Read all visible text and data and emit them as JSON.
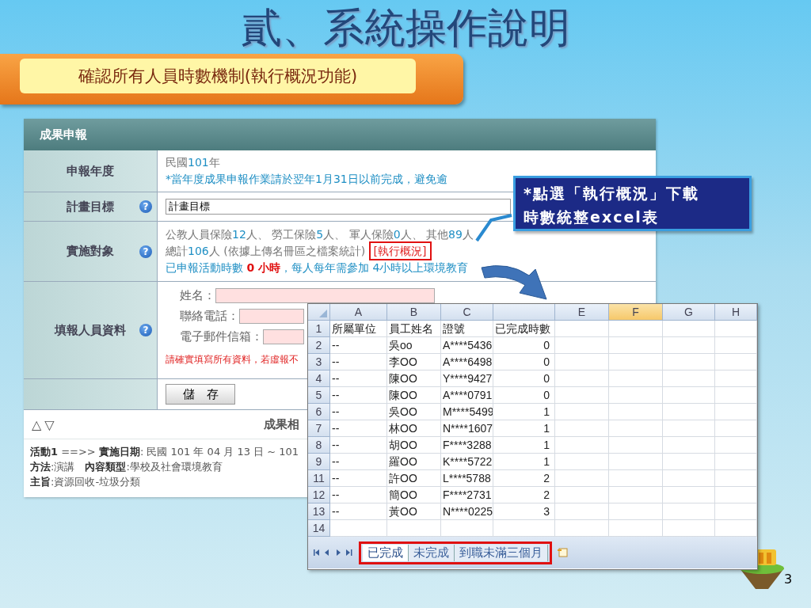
{
  "slide": {
    "title": "貳、系統操作說明",
    "subtitle": "確認所有人員時數機制(執行概況功能)",
    "page_number": "3"
  },
  "form": {
    "header": "成果申報",
    "rows": [
      {
        "kind": "text",
        "label": "申報年度",
        "lines": [
          [
            {
              "text": "民國",
              "kind": "plain"
            },
            {
              "text": "101",
              "kind": "accent"
            },
            {
              "text": "年",
              "kind": "plain"
            }
          ],
          [
            {
              "text": "*當年度成果申報作業請於翌年1月31日以前完成，避免逾",
              "kind": "accent"
            }
          ]
        ]
      },
      {
        "kind": "input",
        "label": "計畫目標",
        "help": "?",
        "value": "計畫目標"
      },
      {
        "kind": "text",
        "label": "實施對象",
        "help": "?",
        "lines": [
          [
            {
              "text": "公教人員保險",
              "kind": "plain"
            },
            {
              "text": "12",
              "kind": "accent"
            },
            {
              "text": "人、 勞工保險",
              "kind": "plain"
            },
            {
              "text": "5",
              "kind": "accent"
            },
            {
              "text": "人、 軍人保險",
              "kind": "plain"
            },
            {
              "text": "0",
              "kind": "accent"
            },
            {
              "text": "人、 其他",
              "kind": "plain"
            },
            {
              "text": "89",
              "kind": "accent"
            },
            {
              "text": "人",
              "kind": "plain"
            }
          ],
          [
            {
              "text": "總計",
              "kind": "plain"
            },
            {
              "text": "106",
              "kind": "accent"
            },
            {
              "text": "人 (依據上傳名冊區之檔案統計) ",
              "kind": "plain"
            },
            {
              "text": "[執行概況]",
              "kind": "link"
            }
          ],
          [
            {
              "text": "已申報活動時數 ",
              "kind": "accent"
            },
            {
              "text": "0 小時",
              "kind": "alert"
            },
            {
              "text": "，每人每年需參加 4小時以上環境教育",
              "kind": "accent"
            }
          ]
        ]
      },
      {
        "kind": "contact",
        "label": "填報人員資料",
        "help": "?",
        "fields": [
          {
            "label": "姓名："
          },
          {
            "label": "聯絡電話："
          },
          {
            "label": "電子郵件信箱："
          }
        ],
        "note": "請確實填寫所有資料，若虛報不"
      },
      {
        "kind": "button",
        "button": "儲　存"
      }
    ],
    "sort_controls": [
      "△",
      "▽"
    ],
    "section_title": "成果相",
    "activity": [
      "**活動1** ==>> **實施日期**: 民國 101 年 04 月 13 日 ~ 101",
      "**方法**:演講　**內容類型**:學校及社會環境教育",
      "**主旨**:資源回收-垃圾分類"
    ]
  },
  "callout": {
    "lines": [
      "*點選「執行概況」下載",
      "時數統整excel表"
    ]
  },
  "spreadsheet": {
    "columns": [
      {
        "label": "A",
        "selected": false
      },
      {
        "label": "B",
        "selected": false
      },
      {
        "label": "C",
        "selected": false
      },
      {
        "selected": false
      },
      {
        "label": "E",
        "selected": false
      },
      {
        "label": "F",
        "selected": true
      },
      {
        "label": "G",
        "selected": false
      },
      {
        "label": "H",
        "selected": false
      }
    ],
    "rows": [
      {
        "number": "1",
        "cells": [
          "所屬單位",
          "員工姓名",
          "證號",
          "已完成時數"
        ]
      },
      {
        "number": "2",
        "cells": [
          "--",
          "吳oo",
          "A****5436",
          "0"
        ]
      },
      {
        "number": "3",
        "cells": [
          "--",
          "李OO",
          "A****6498",
          "0"
        ]
      },
      {
        "number": "4",
        "cells": [
          "--",
          "陳OO",
          "Y****9427",
          "0"
        ]
      },
      {
        "number": "5",
        "cells": [
          "--",
          "陳OO",
          "A****0791",
          "0"
        ]
      },
      {
        "number": "6",
        "cells": [
          "--",
          "吳OO",
          "M****5499",
          "1"
        ]
      },
      {
        "number": "7",
        "cells": [
          "--",
          "林OO",
          "N****1607",
          "1"
        ]
      },
      {
        "number": "8",
        "cells": [
          "--",
          "胡OO",
          "F****3288",
          "1"
        ]
      },
      {
        "number": "9",
        "cells": [
          "--",
          "羅OO",
          "K****5722",
          "1"
        ]
      },
      {
        "number": "11",
        "cells": [
          "--",
          "許OO",
          "L****5788",
          "2"
        ]
      },
      {
        "number": "12",
        "cells": [
          "--",
          "簡OO",
          "F****2731",
          "2"
        ]
      },
      {
        "number": "13",
        "cells": [
          "--",
          "黃OO",
          "N****0225",
          "3"
        ]
      },
      {
        "number": "14"
      }
    ],
    "sheets": [
      {
        "label": "已完成",
        "selected": true
      },
      {
        "label": "未完成",
        "selected": false
      },
      {
        "label": "到職未滿三個月",
        "selected": false
      }
    ]
  }
}
